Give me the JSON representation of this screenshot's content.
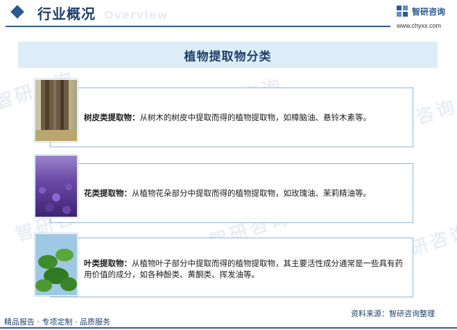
{
  "header": {
    "title": "行业概况",
    "title_en": "Overview",
    "brand_name": "智研咨询",
    "brand_url": "www.chyxx.com",
    "accent_color": "#2c5a8f"
  },
  "banner": {
    "text": "植物提取物分类"
  },
  "items": [
    {
      "label": "树皮类提取物：",
      "text": "从树木的树皮中提取而得的植物提取物，如樟脑油、悬铃木素等。",
      "image": "tree-bark-photo"
    },
    {
      "label": "花类提取物：",
      "text": "从植物花朵部分中提取而得的植物提取物，如玫瑰油、茉莉精油等。",
      "image": "lavender-field-photo"
    },
    {
      "label": "叶类提取物：",
      "text": "从植物叶子部分中提取而得的植物提取物，其主要活性成分通常是一些具有药用价值的成分，如各种酚类、黄酮类、挥发油等。",
      "image": "green-leaves-photo"
    }
  ],
  "footer": {
    "services": "精品报告 · 专项定制 · 品质服务",
    "source": "资料来源：智研咨询整理"
  },
  "watermark": {
    "text": "智研咨询"
  }
}
